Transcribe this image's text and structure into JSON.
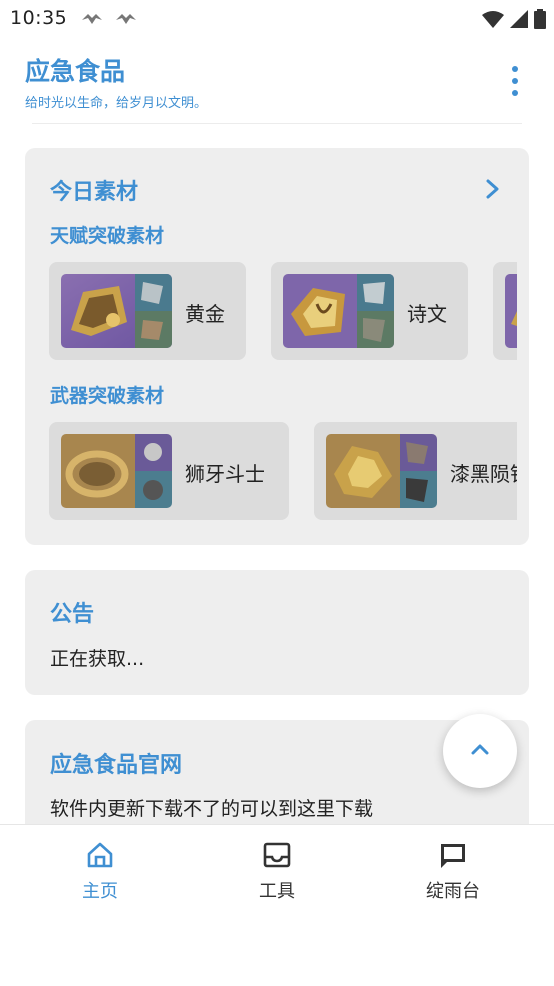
{
  "status_bar": {
    "time": "10:35"
  },
  "header": {
    "title": "应急食品",
    "subtitle": "给时光以生命，给岁月以文明。"
  },
  "today_materials": {
    "title": "今日素材",
    "talent_section": "天赋突破素材",
    "talent_items": [
      {
        "name": "黄金"
      },
      {
        "name": "诗文"
      }
    ],
    "weapon_section": "武器突破素材",
    "weapon_items": [
      {
        "name": "狮牙斗士"
      },
      {
        "name": "漆黑陨铁"
      }
    ]
  },
  "announcement": {
    "title": "公告",
    "text": "正在获取..."
  },
  "official_site": {
    "title": "应急食品官网",
    "text": "软件内更新下载不了的可以到这里下载"
  },
  "bottom_nav": {
    "items": [
      {
        "label": "主页",
        "icon": "home-icon",
        "active": true
      },
      {
        "label": "工具",
        "icon": "inbox-icon",
        "active": false
      },
      {
        "label": "绽雨台",
        "icon": "chat-icon",
        "active": false
      }
    ]
  },
  "colors": {
    "accent": "#3f8fd2",
    "card_bg": "#eeeeee",
    "item_bg": "#dcdcdc",
    "nav_inactive": "#333333"
  }
}
